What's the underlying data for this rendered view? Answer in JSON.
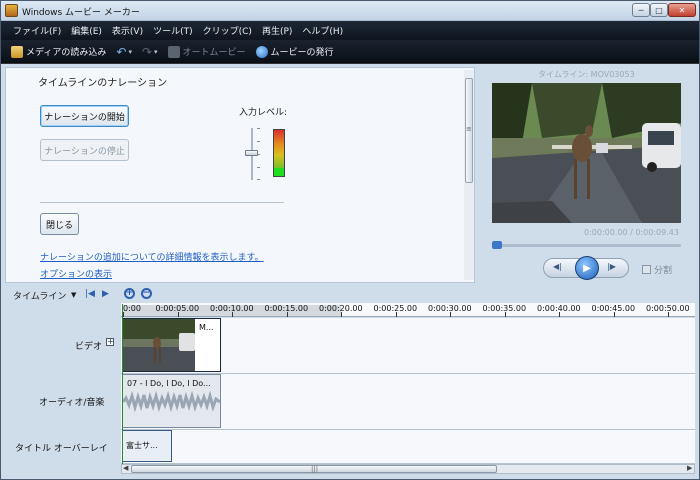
{
  "window": {
    "title": "Windows ムービー メーカー",
    "min_glyph": "─",
    "max_glyph": "□",
    "close_glyph": "✕"
  },
  "menu": [
    "ファイル(F)",
    "編集(E)",
    "表示(V)",
    "ツール(T)",
    "クリップ(C)",
    "再生(P)",
    "ヘルプ(H)"
  ],
  "toolbar": {
    "import_label": "メディアの読み込み",
    "undo_glyph": "↶",
    "redo_glyph": "↷",
    "caret_glyph": "▾",
    "automovie_label": "オートムービー",
    "publish_label": "ムービーの発行"
  },
  "narration": {
    "title": "タイムラインのナレーション",
    "start_label": "ナレーションの開始",
    "stop_label": "ナレーションの停止",
    "input_level_label": "入力レベル:",
    "close_label": "閉じる",
    "info_link": "ナレーションの追加についての詳細情報を表示します。",
    "options_link": "オプションの表示",
    "scroll_grip": "≡"
  },
  "preview": {
    "caption": "タイムライン: MOV03053",
    "time": "0:00:00.00 / 0:00:09.43",
    "prev_glyph": "◀|",
    "play_glyph": "▶",
    "next_glyph": "|▶",
    "split_label": "分割",
    "seek_fraction": 0.0
  },
  "timeline": {
    "label": "タイムライン",
    "caret_glyph": "▼",
    "rewind_glyph": "|◀",
    "play_glyph": "▶",
    "zoom_in_glyph": "+",
    "zoom_out_glyph": "−",
    "ruler_labels": [
      "0:00",
      "0:00:05.00",
      "0:00:10.00",
      "0:00:15.00",
      "0:00:20.00",
      "0:00:25.00",
      "0:00:30.00",
      "0:00:35.00",
      "0:00:40.00",
      "0:00:45.00",
      "0:00:50.00"
    ],
    "tracks": {
      "video": "ビデオ",
      "audio": "オーディオ/音楽",
      "title_overlay": "タイトル オーバーレイ"
    },
    "expand_glyph": "+",
    "video_clip_label": "M...",
    "audio_clip_label": "07 - I Do, I Do, I Do...",
    "title_clip_label": "富士サ...",
    "scroll_left": "◀",
    "scroll_right": "▶",
    "scroll_grip": "|||"
  }
}
